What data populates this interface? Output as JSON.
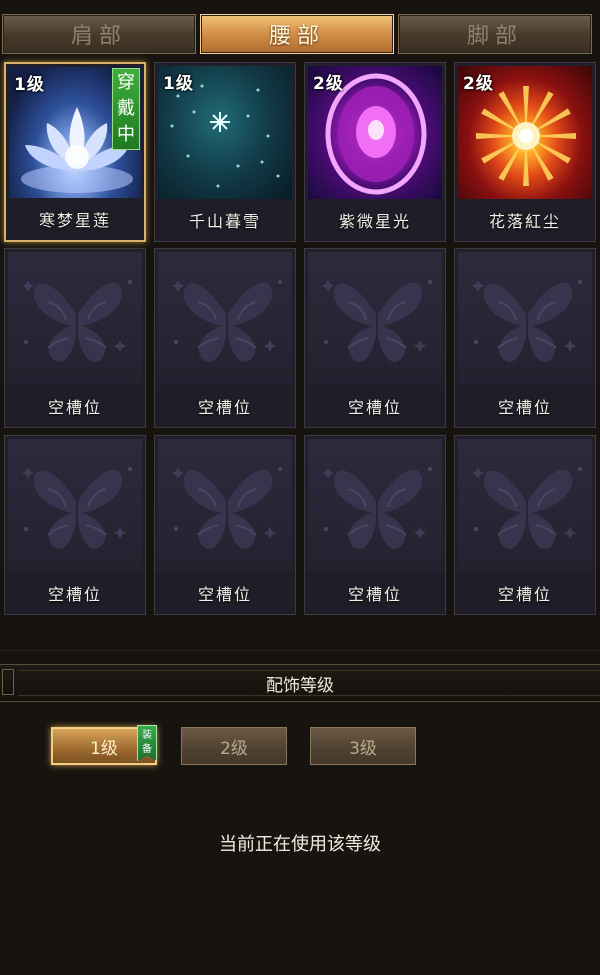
{
  "tabs": [
    {
      "label": "肩部",
      "active": false
    },
    {
      "label": "腰部",
      "active": true
    },
    {
      "label": "脚部",
      "active": false
    }
  ],
  "items": [
    {
      "name": "寒梦星莲",
      "level": "1级",
      "wearing": "穿戴中",
      "art": "lotus",
      "selected": true
    },
    {
      "name": "千山暮雪",
      "level": "1级",
      "art": "snow"
    },
    {
      "name": "紫微星光",
      "level": "2级",
      "art": "violet"
    },
    {
      "name": "花落紅尘",
      "level": "2级",
      "art": "star"
    },
    {
      "name": "空槽位"
    },
    {
      "name": "空槽位"
    },
    {
      "name": "空槽位"
    },
    {
      "name": "空槽位"
    },
    {
      "name": "空槽位"
    },
    {
      "name": "空槽位"
    },
    {
      "name": "空槽位"
    },
    {
      "name": "空槽位"
    }
  ],
  "section": {
    "title": "配饰等级"
  },
  "level_buttons": [
    {
      "label": "1级",
      "active": true
    },
    {
      "label": "2级",
      "active": false
    },
    {
      "label": "3级",
      "active": false
    }
  ],
  "equip_tag": "装备",
  "status": "当前正在使用该等级",
  "colors": {
    "accent": "#d4924a",
    "wearing_green": "#2f9a2f",
    "panel_bg": "#171410"
  }
}
